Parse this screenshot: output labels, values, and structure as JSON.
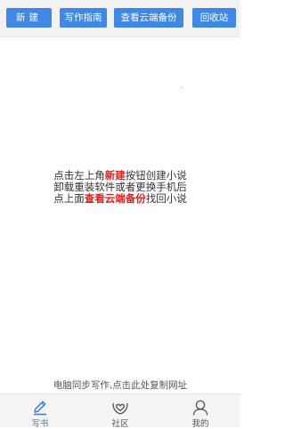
{
  "toolbar": {
    "new_label": "新建",
    "guide_label": "写作指南",
    "cloud_label": "查看云端备份",
    "bin_label": "回收站"
  },
  "hint": {
    "line1_a": "点击左上角",
    "line1_b": "新建",
    "line1_c": "按钮创建小说",
    "line2": "卸载重装软件或者更换手机后",
    "line3_a": "点上面",
    "line3_b": "查看云端备份",
    "line3_c": "找回小说"
  },
  "sync_text": "电脑同步写作,点击此处复制网址",
  "tabs": [
    {
      "label": "写书",
      "icon": "pen-icon"
    },
    {
      "label": "社区",
      "icon": "heart-hands-icon"
    },
    {
      "label": "我的",
      "icon": "user-icon"
    }
  ],
  "colors": {
    "accent": "#3f88e6",
    "highlight": "#e51e1e",
    "active_tab": "#3f7fe0"
  }
}
